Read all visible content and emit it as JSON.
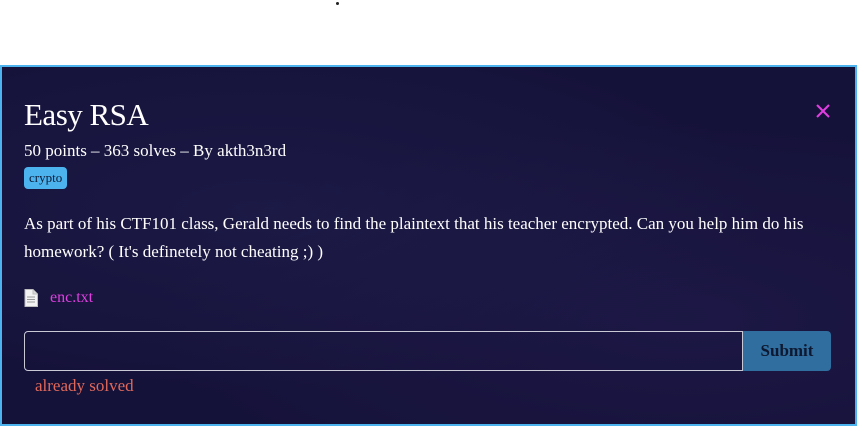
{
  "challenge": {
    "title": "Easy RSA",
    "subtitle": "50 points – 363 solves – By akth3n3rd",
    "tag": "crypto",
    "description": "As part of his CTF101 class, Gerald needs to find the plaintext that his teacher encrypted. Can you help him do his homework? ( It's definetely not cheating ;) )",
    "file": {
      "name": "enc.txt",
      "icon": "file-icon"
    }
  },
  "form": {
    "input_value": "",
    "submit_label": "Submit",
    "status_text": "already solved"
  },
  "colors": {
    "background": "#15123a",
    "border": "#4db3ef",
    "tag_bg": "#4db3ef",
    "close": "#e03ee0",
    "link": "#e03ee0",
    "submit_bg": "#2f6e9e",
    "status": "#e0685a"
  }
}
